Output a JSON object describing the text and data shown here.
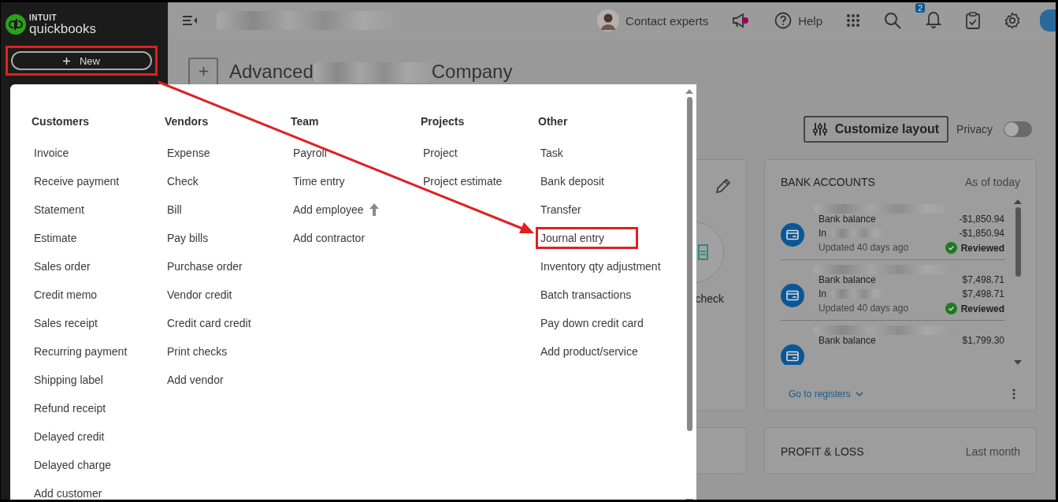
{
  "sidebar": {
    "logo_top": "INTUIT",
    "logo_bottom": "quickbooks",
    "new_button": {
      "label": "New",
      "highlighted": true
    }
  },
  "topbar": {
    "contact": "Contact experts",
    "help": "Help",
    "notification_count": "2"
  },
  "page": {
    "title_start": "Advanced",
    "title_end": "Company",
    "customize": "Customize layout",
    "privacy": {
      "label": "Privacy",
      "on": false
    },
    "partial_card": {
      "label": "check"
    },
    "bank_accounts": {
      "title": "BANK ACCOUNTS",
      "subtitle": "As of today",
      "accounts": [
        {
          "balance_label": "Bank balance",
          "balance": "-$1,850.94",
          "in_label": "In",
          "in_amount": "-$1,850.94",
          "updated": "Updated 40 days ago",
          "status": "Reviewed"
        },
        {
          "balance_label": "Bank balance",
          "balance": "$7,498.71",
          "in_label": "In",
          "in_amount": "$7,498.71",
          "updated": "Updated 40 days ago",
          "status": "Reviewed"
        },
        {
          "balance_label": "Bank balance",
          "balance": "$1,799.30"
        }
      ],
      "link": "Go to registers"
    },
    "profit_loss": {
      "title": "PROFIT & LOSS",
      "period": "Last month"
    }
  },
  "new_menu": {
    "columns": [
      {
        "heading": "Customers",
        "items": [
          {
            "label": "Invoice",
            "highlighted": false,
            "upgrade": false
          },
          {
            "label": "Receive payment",
            "highlighted": false,
            "upgrade": false
          },
          {
            "label": "Statement",
            "highlighted": false,
            "upgrade": false
          },
          {
            "label": "Estimate",
            "highlighted": false,
            "upgrade": false
          },
          {
            "label": "Sales order",
            "highlighted": false,
            "upgrade": false
          },
          {
            "label": "Credit memo",
            "highlighted": false,
            "upgrade": false
          },
          {
            "label": "Sales receipt",
            "highlighted": false,
            "upgrade": false
          },
          {
            "label": "Recurring payment",
            "highlighted": false,
            "upgrade": false
          },
          {
            "label": "Shipping label",
            "highlighted": false,
            "upgrade": false
          },
          {
            "label": "Refund receipt",
            "highlighted": false,
            "upgrade": false
          },
          {
            "label": "Delayed credit",
            "highlighted": false,
            "upgrade": false
          },
          {
            "label": "Delayed charge",
            "highlighted": false,
            "upgrade": false
          },
          {
            "label": "Add customer",
            "highlighted": false,
            "upgrade": false
          }
        ]
      },
      {
        "heading": "Vendors",
        "items": [
          {
            "label": "Expense",
            "highlighted": false,
            "upgrade": false
          },
          {
            "label": "Check",
            "highlighted": false,
            "upgrade": false
          },
          {
            "label": "Bill",
            "highlighted": false,
            "upgrade": false
          },
          {
            "label": "Pay bills",
            "highlighted": false,
            "upgrade": false
          },
          {
            "label": "Purchase order",
            "highlighted": false,
            "upgrade": false
          },
          {
            "label": "Vendor credit",
            "highlighted": false,
            "upgrade": false
          },
          {
            "label": "Credit card credit",
            "highlighted": false,
            "upgrade": false
          },
          {
            "label": "Print checks",
            "highlighted": false,
            "upgrade": false
          },
          {
            "label": "Add vendor",
            "highlighted": false,
            "upgrade": false
          }
        ]
      },
      {
        "heading": "Team",
        "items": [
          {
            "label": "Payroll",
            "highlighted": false,
            "upgrade": false
          },
          {
            "label": "Time entry",
            "highlighted": false,
            "upgrade": false
          },
          {
            "label": "Add employee",
            "highlighted": false,
            "upgrade": true
          },
          {
            "label": "Add contractor",
            "highlighted": false,
            "upgrade": false
          }
        ]
      },
      {
        "heading": "Projects",
        "items": [
          {
            "label": "Project",
            "highlighted": false,
            "upgrade": false
          },
          {
            "label": "Project estimate",
            "highlighted": false,
            "upgrade": false
          }
        ]
      },
      {
        "heading": "Other",
        "items": [
          {
            "label": "Task",
            "highlighted": false,
            "upgrade": false
          },
          {
            "label": "Bank deposit",
            "highlighted": false,
            "upgrade": false
          },
          {
            "label": "Transfer",
            "highlighted": false,
            "upgrade": false
          },
          {
            "label": "Journal entry",
            "highlighted": true,
            "upgrade": false
          },
          {
            "label": "Inventory qty adjustment",
            "highlighted": false,
            "upgrade": false
          },
          {
            "label": "Batch transactions",
            "highlighted": false,
            "upgrade": false
          },
          {
            "label": "Pay down credit card",
            "highlighted": false,
            "upgrade": false
          },
          {
            "label": "Add product/service",
            "highlighted": false,
            "upgrade": false
          }
        ]
      }
    ]
  }
}
